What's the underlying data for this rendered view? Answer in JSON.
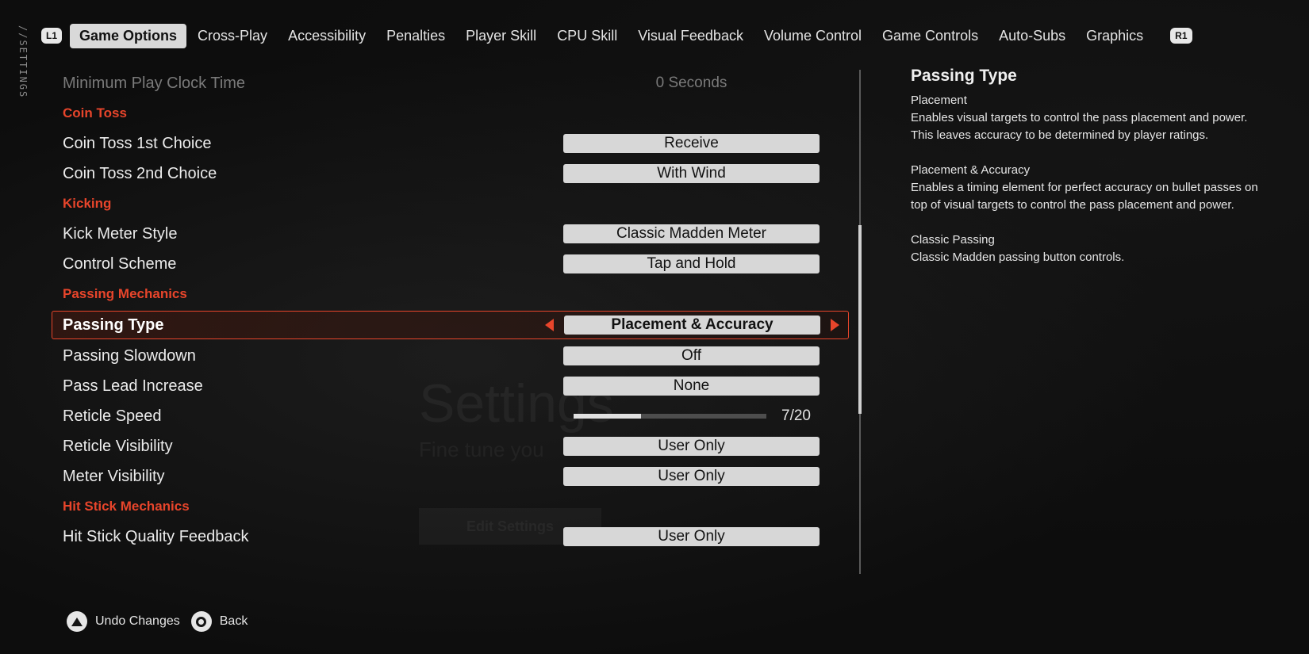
{
  "sidebar": {
    "vertical_label": "//SETTINGS"
  },
  "nav": {
    "left_bumper": "L1",
    "right_bumper": "R1",
    "tabs": [
      {
        "label": "Game Options",
        "active": true
      },
      {
        "label": "Cross-Play"
      },
      {
        "label": "Accessibility"
      },
      {
        "label": "Penalties"
      },
      {
        "label": "Player Skill"
      },
      {
        "label": "CPU Skill"
      },
      {
        "label": "Visual Feedback"
      },
      {
        "label": "Volume Control"
      },
      {
        "label": "Game Controls"
      },
      {
        "label": "Auto-Subs"
      },
      {
        "label": "Graphics"
      }
    ]
  },
  "settings": {
    "min_play_clock": {
      "label": "Minimum Play Clock Time",
      "value": "0 Seconds"
    },
    "coin_toss_header": "Coin Toss",
    "coin_toss_1": {
      "label": "Coin Toss 1st Choice",
      "value": "Receive"
    },
    "coin_toss_2": {
      "label": "Coin Toss 2nd Choice",
      "value": "With Wind"
    },
    "kicking_header": "Kicking",
    "kick_meter": {
      "label": "Kick Meter Style",
      "value": "Classic Madden Meter"
    },
    "control_scheme": {
      "label": "Control Scheme",
      "value": "Tap and Hold"
    },
    "passing_header": "Passing Mechanics",
    "passing_type": {
      "label": "Passing Type",
      "value": "Placement & Accuracy"
    },
    "passing_slowdown": {
      "label": "Passing Slowdown",
      "value": "Off"
    },
    "pass_lead": {
      "label": "Pass Lead Increase",
      "value": "None"
    },
    "reticle_speed": {
      "label": "Reticle Speed",
      "value": "7/20",
      "current": 7,
      "max": 20
    },
    "reticle_visibility": {
      "label": "Reticle Visibility",
      "value": "User Only"
    },
    "meter_visibility": {
      "label": "Meter Visibility",
      "value": "User Only"
    },
    "hit_stick_header": "Hit Stick Mechanics",
    "hit_stick_feedback": {
      "label": "Hit Stick Quality Feedback",
      "value": "User Only"
    }
  },
  "info": {
    "title": "Passing Type",
    "blocks": [
      {
        "title": "Placement",
        "desc": "Enables visual targets to control the pass placement and power. This leaves accuracy to be determined by player ratings."
      },
      {
        "title": "Placement & Accuracy",
        "desc": "Enables a timing element for perfect accuracy on bullet passes on top of visual targets to control the pass placement and power."
      },
      {
        "title": "Classic Passing",
        "desc": "Classic Madden passing button controls."
      }
    ]
  },
  "hints": {
    "undo": {
      "label": "Undo Changes",
      "icon": "triangle-button-icon"
    },
    "back": {
      "label": "Back",
      "icon": "circle-button-icon"
    }
  },
  "background": {
    "heading": "Settings",
    "subheading": "Fine tune you",
    "button": "Edit Settings"
  },
  "colors": {
    "accent": "#e8452b",
    "pill": "#d7d7d7",
    "background": "#0d0d0d"
  }
}
